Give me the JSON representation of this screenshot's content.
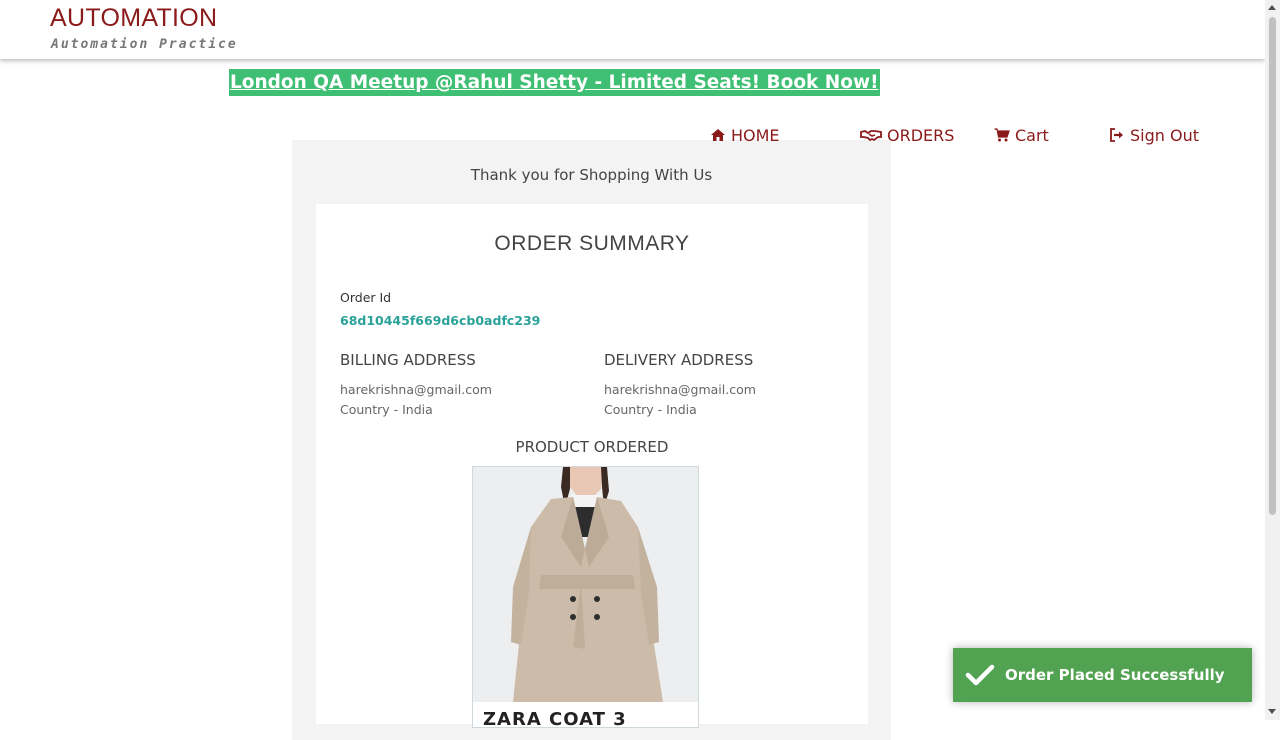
{
  "header": {
    "title": "AUTOMATION",
    "subtitle": "Automation Practice"
  },
  "banner": {
    "text": "London QA Meetup @Rahul Shetty - Limited Seats! Book Now!"
  },
  "nav": {
    "home": "HOME",
    "orders": "ORDERS",
    "cart": "Cart",
    "sign_out": "Sign Out"
  },
  "page": {
    "thanks": "Thank you for Shopping With Us",
    "summary_title": "ORDER SUMMARY",
    "order_id_label": "Order Id",
    "order_id": "68d10445f669d6cb0adfc239",
    "billing": {
      "heading": "BILLING ADDRESS",
      "email": "harekrishna@gmail.com",
      "country": "Country - India"
    },
    "delivery": {
      "heading": "DELIVERY ADDRESS",
      "email": "harekrishna@gmail.com",
      "country": "Country - India"
    },
    "product_heading": "PRODUCT ORDERED",
    "product_name": "ZARA COAT 3"
  },
  "toast": {
    "message": "Order Placed Successfully"
  },
  "colors": {
    "brand": "#8b1a1a",
    "banner": "#3fbf73",
    "order_id": "#2aa29a",
    "toast": "#51a351"
  }
}
